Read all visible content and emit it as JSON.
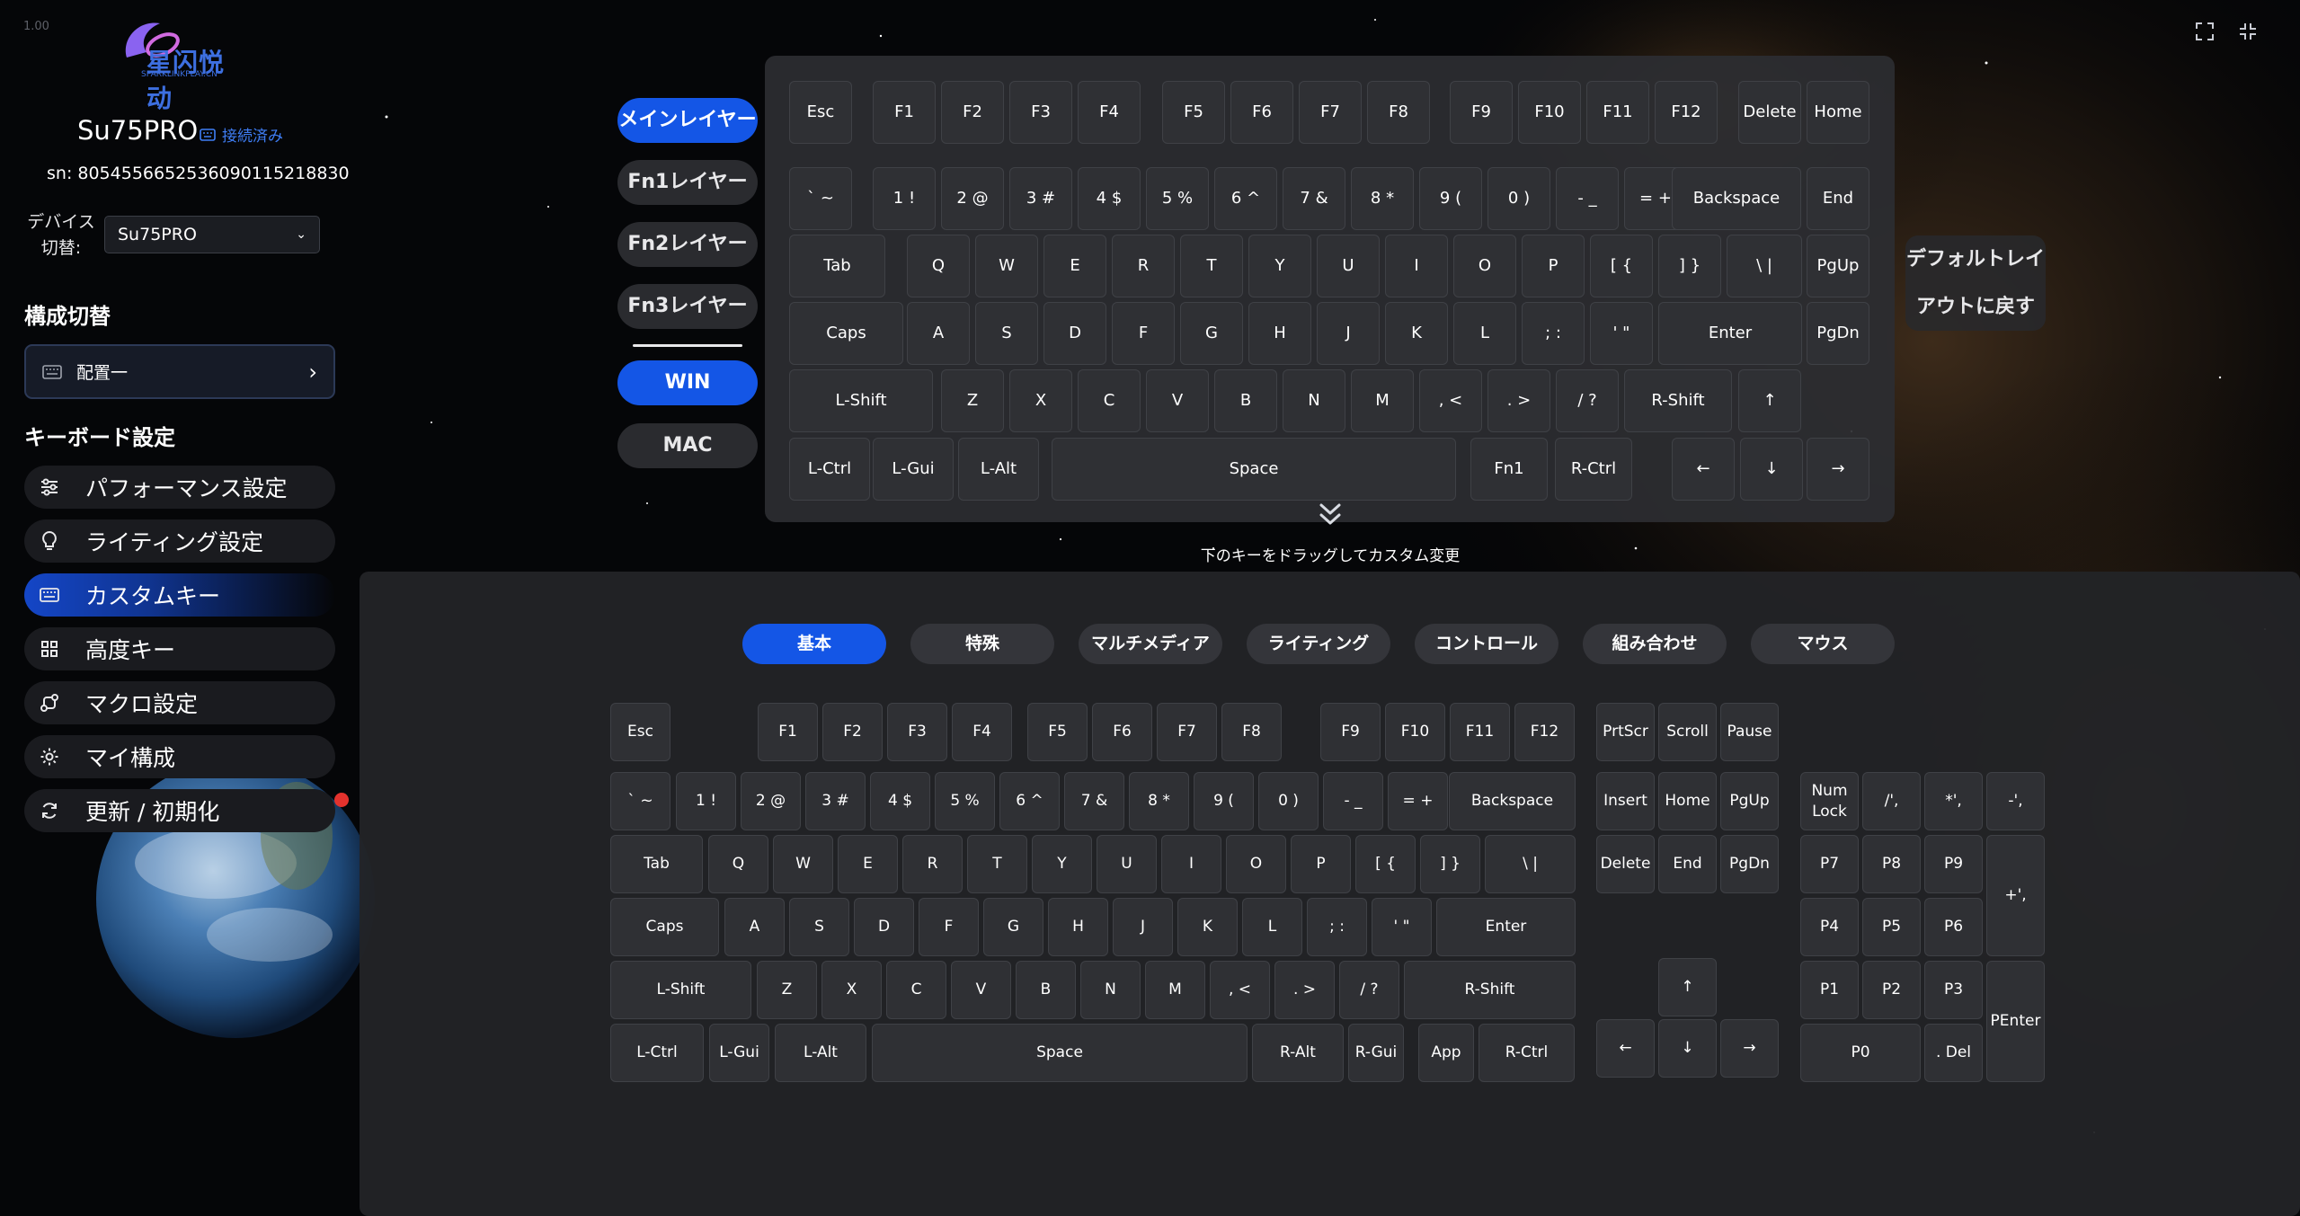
{
  "app": {
    "version": "1.00",
    "logo_text": "星闪悦动",
    "logo_subtext": "SPARKLINKPLAY.CN"
  },
  "window_controls": [
    {
      "icon": "expand-icon"
    },
    {
      "icon": "shrink-icon"
    }
  ],
  "device": {
    "name": "Su75PRO",
    "status": "接続済み",
    "sn": "sn: 8054556652536090115218830",
    "switch_label": "デバイス切替:",
    "selected": "Su75PRO"
  },
  "config": {
    "heading": "構成切替",
    "current": "配置一"
  },
  "settings": {
    "heading": "キーボード設定",
    "items": [
      {
        "label": "パフォーマンス設定",
        "icon": "sliders-icon"
      },
      {
        "label": "ライティング設定",
        "icon": "bulb-icon"
      },
      {
        "label": "カスタムキー",
        "icon": "keyboard-icon"
      },
      {
        "label": "高度キー",
        "icon": "grid-icon"
      },
      {
        "label": "マクロ設定",
        "icon": "macro-icon"
      },
      {
        "label": "マイ構成",
        "icon": "gear-icon"
      },
      {
        "label": "更新 / 初期化",
        "icon": "refresh-icon"
      }
    ],
    "active_index": 2
  },
  "layers": {
    "items": [
      "メインレイヤー",
      "Fn1レイヤー",
      "Fn2レイヤー",
      "Fn3レイヤー"
    ],
    "active_index": 0,
    "os": [
      "WIN",
      "MAC"
    ],
    "active_os": 0
  },
  "reset_button": "デフォルトレイアウトに戻す",
  "drag_hint": "下のキーをドラッグしてカスタム変更",
  "categories": {
    "items": [
      "基本",
      "特殊",
      "マルチメディア",
      "ライティング",
      "コントロール",
      "組み合わせ",
      "マウス"
    ],
    "active_index": 0
  },
  "top_keyboard": [
    [
      "Esc",
      "F1",
      "F2",
      "F3",
      "F4",
      "F5",
      "F6",
      "F7",
      "F8",
      "F9",
      "F10",
      "F11",
      "F12",
      "Delete",
      "Home"
    ],
    [
      "` ~",
      "1 !",
      "2 @",
      "3 #",
      "4 $",
      "5 %",
      "6 ^",
      "7 &",
      "8 *",
      "9 (",
      "0 )",
      "- _",
      "= +",
      "Backspace",
      "End"
    ],
    [
      "Tab",
      "Q",
      "W",
      "E",
      "R",
      "T",
      "Y",
      "U",
      "I",
      "O",
      "P",
      "[ {",
      "] }",
      "\\ |",
      "PgUp"
    ],
    [
      "Caps",
      "A",
      "S",
      "D",
      "F",
      "G",
      "H",
      "J",
      "K",
      "L",
      "; :",
      "' \"",
      "Enter",
      "PgDn"
    ],
    [
      "L-Shift",
      "Z",
      "X",
      "C",
      "V",
      "B",
      "N",
      "M",
      ", <",
      ". >",
      "/ ?",
      "R-Shift",
      "↑"
    ],
    [
      "L-Ctrl",
      "L-Gui",
      "L-Alt",
      "Space",
      "Fn1",
      "R-Ctrl",
      "←",
      "↓",
      "→"
    ]
  ],
  "bottom_keyboard": {
    "main": [
      [
        "Esc",
        "F1",
        "F2",
        "F3",
        "F4",
        "F5",
        "F6",
        "F7",
        "F8",
        "F9",
        "F10",
        "F11",
        "F12"
      ],
      [
        "` ~",
        "1 !",
        "2 @",
        "3 #",
        "4 $",
        "5 %",
        "6 ^",
        "7 &",
        "8 *",
        "9 (",
        "0 )",
        "- _",
        "= +",
        "Backspace"
      ],
      [
        "Tab",
        "Q",
        "W",
        "E",
        "R",
        "T",
        "Y",
        "U",
        "I",
        "O",
        "P",
        "[ {",
        "] }",
        "\\ |"
      ],
      [
        "Caps",
        "A",
        "S",
        "D",
        "F",
        "G",
        "H",
        "J",
        "K",
        "L",
        "; :",
        "' \"",
        "Enter"
      ],
      [
        "L-Shift",
        "Z",
        "X",
        "C",
        "V",
        "B",
        "N",
        "M",
        ", <",
        ". >",
        "/ ?",
        "R-Shift"
      ],
      [
        "L-Ctrl",
        "L-Gui",
        "L-Alt",
        "Space",
        "R-Alt",
        "R-Gui",
        "App",
        "R-Ctrl"
      ]
    ],
    "nav": [
      [
        "PrtScr",
        "Scroll",
        "Pause"
      ],
      [
        "Insert",
        "Home",
        "PgUp"
      ],
      [
        "Delete",
        "End",
        "PgDn"
      ],
      [
        "↑"
      ],
      [
        "←",
        "↓",
        "→"
      ]
    ],
    "numpad": [
      [
        "Num\nLock",
        "/',",
        "*',",
        "-',"
      ],
      [
        "P7",
        "P8",
        "P9",
        "+',"
      ],
      [
        "P4",
        "P5",
        "P6"
      ],
      [
        "P1",
        "P2",
        "P3",
        "PEnter"
      ],
      [
        "P0",
        ". Del"
      ]
    ]
  }
}
